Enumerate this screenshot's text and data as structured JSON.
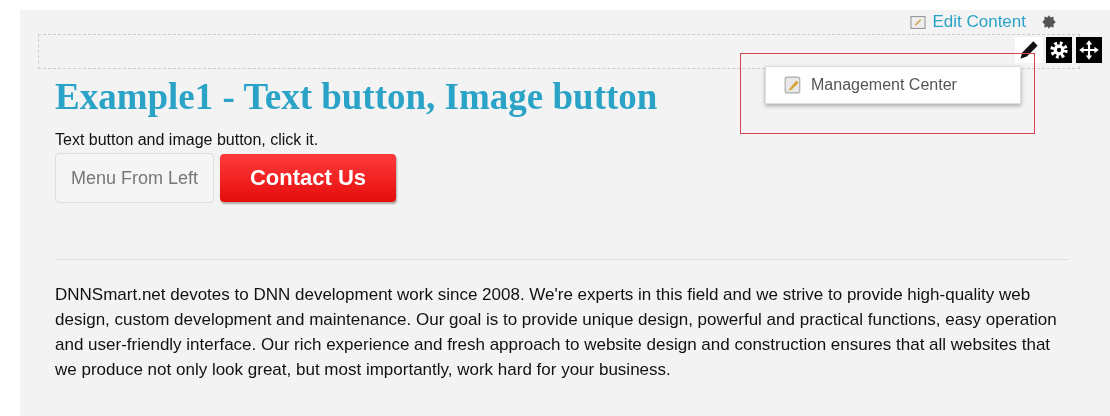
{
  "top_links": {
    "edit_content": "Edit Content"
  },
  "menu": {
    "items": [
      {
        "label": "Management Center"
      }
    ]
  },
  "title": "Example1 - Text button, Image button",
  "intro": "Text button and image button, click it.",
  "buttons": {
    "text_button": "Menu From Left",
    "image_button": "Contact Us"
  },
  "paragraph": "DNNSmart.net devotes to DNN development work since 2008. We're experts in this field and we strive to provide high-quality web design, custom development and maintenance. Our goal is to provide unique design, powerful and practical functions, easy operation and user-friendly interface. Our rich experience and fresh approach to website design and construction ensures that all websites that we produce not only look great, but most importantly, work hard for your business."
}
